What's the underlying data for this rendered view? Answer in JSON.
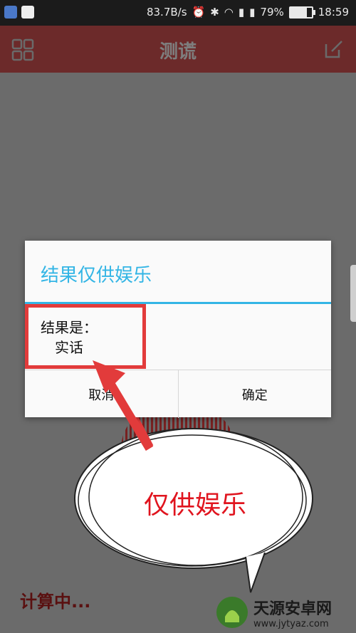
{
  "status_bar": {
    "speed": "83.7B/s",
    "battery": "79%",
    "battery_level": 0.79,
    "time": "18:59"
  },
  "app_bar": {
    "title": "测谎",
    "menu_icon": "grid-icon",
    "edit_icon": "edit-icon"
  },
  "dialog": {
    "title": "结果仅供娱乐",
    "message_line1": "结果是：",
    "message_line2": "实话",
    "cancel_label": "取消",
    "ok_label": "确定",
    "accent_color": "#33b5e5"
  },
  "bubble": {
    "text": "仅供娱乐",
    "color": "#e0141e"
  },
  "status_text": "计算中...",
  "watermark": {
    "name": "天源安卓网",
    "url": "www.jytyaz.com"
  }
}
